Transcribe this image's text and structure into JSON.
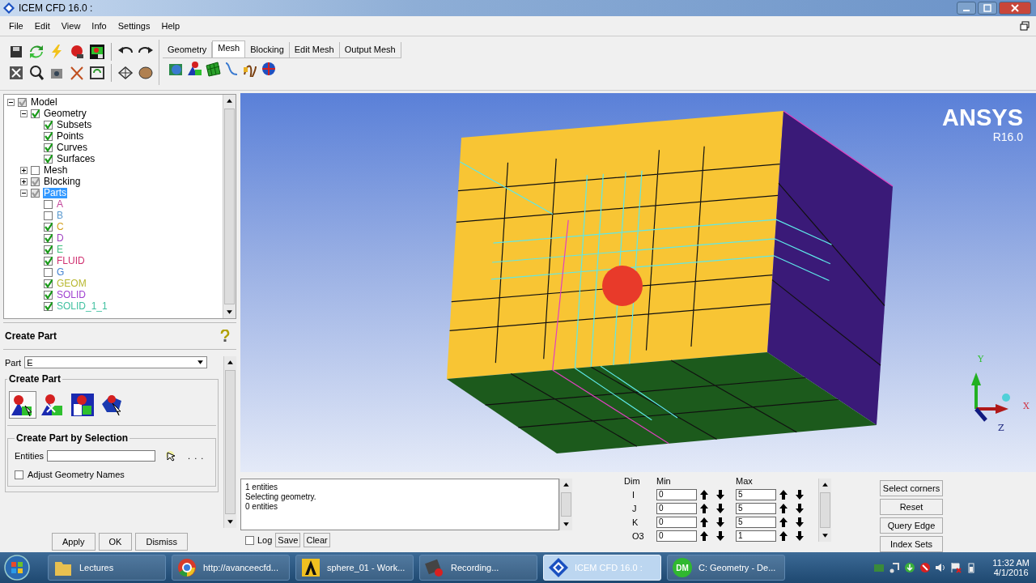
{
  "window": {
    "title": "ICEM CFD 16.0 :"
  },
  "menu": [
    "File",
    "Edit",
    "View",
    "Info",
    "Settings",
    "Help"
  ],
  "tabs": [
    {
      "label": "Geometry",
      "selected": false
    },
    {
      "label": "Mesh",
      "selected": true
    },
    {
      "label": "Blocking",
      "selected": false
    },
    {
      "label": "Edit Mesh",
      "selected": false
    },
    {
      "label": "Output Mesh",
      "selected": false
    }
  ],
  "tree": [
    {
      "label": "Model",
      "checked": true,
      "mixed": true,
      "expanded": true,
      "selected": false,
      "children": [
        {
          "label": "Geometry",
          "checked": true,
          "mixed": false,
          "expanded": true,
          "selected": false,
          "children": [
            {
              "label": "Subsets",
              "checked": true,
              "mixed": false,
              "selected": false
            },
            {
              "label": "Points",
              "checked": true,
              "mixed": false,
              "selected": false
            },
            {
              "label": "Curves",
              "checked": true,
              "mixed": false,
              "selected": false
            },
            {
              "label": "Surfaces",
              "checked": true,
              "mixed": false,
              "selected": false
            }
          ]
        },
        {
          "label": "Mesh",
          "checked": false,
          "mixed": false,
          "expanded": false,
          "selected": false
        },
        {
          "label": "Blocking",
          "checked": true,
          "mixed": true,
          "expanded": false,
          "selected": false
        },
        {
          "label": "Parts",
          "checked": true,
          "mixed": true,
          "expanded": true,
          "selected": true,
          "children": [
            {
              "label": "A",
              "checked": false,
              "mixed": false,
              "selected": false,
              "color": "#c4449a"
            },
            {
              "label": "B",
              "checked": false,
              "mixed": false,
              "selected": false,
              "color": "#5a9ad0"
            },
            {
              "label": "C",
              "checked": true,
              "mixed": false,
              "selected": false,
              "color": "#d4a020"
            },
            {
              "label": "D",
              "checked": true,
              "mixed": false,
              "selected": false,
              "color": "#a040c0"
            },
            {
              "label": "E",
              "checked": true,
              "mixed": false,
              "selected": false,
              "color": "#40c080"
            },
            {
              "label": "FLUID",
              "checked": true,
              "mixed": false,
              "selected": false,
              "color": "#d03070"
            },
            {
              "label": "G",
              "checked": false,
              "mixed": false,
              "selected": false,
              "color": "#4080d0"
            },
            {
              "label": "GEOM",
              "checked": true,
              "mixed": false,
              "selected": false,
              "color": "#b8b830"
            },
            {
              "label": "SOLID",
              "checked": true,
              "mixed": false,
              "selected": false,
              "color": "#a040d0"
            },
            {
              "label": "SOLID_1_1",
              "checked": true,
              "mixed": false,
              "selected": false,
              "color": "#40c0a0"
            }
          ]
        }
      ]
    }
  ],
  "panel": {
    "title": "Create Part",
    "part_label": "Part",
    "part_value": "E",
    "group_title": "Create Part",
    "tools": [
      {
        "selected": true
      },
      {
        "selected": false
      },
      {
        "selected": false
      },
      {
        "selected": false
      }
    ],
    "selection_title": "Create Part by Selection",
    "entities_label": "Entities",
    "more": ". . .",
    "adjust": {
      "label": "Adjust Geometry Names",
      "checked": false
    },
    "buttons": [
      "Apply",
      "OK",
      "Dismiss"
    ]
  },
  "viewport": {
    "logo": "ANSYS",
    "version": "R16.0",
    "axes": {
      "y": "Y",
      "x": "X",
      "z": "Z"
    }
  },
  "log": {
    "lines": [
      "1 entities",
      "Selecting geometry.",
      "0 entities"
    ],
    "log_option": {
      "label": "Log",
      "checked": false
    },
    "buttons": [
      "Save",
      "Clear"
    ]
  },
  "index_control": {
    "columns": [
      "Dim",
      "Min",
      "Max"
    ],
    "rows": [
      {
        "dim": "I",
        "min": "0",
        "max": "5"
      },
      {
        "dim": "J",
        "min": "0",
        "max": "5"
      },
      {
        "dim": "K",
        "min": "0",
        "max": "5"
      },
      {
        "dim": "O3",
        "min": "0",
        "max": "1"
      }
    ]
  },
  "side_buttons": [
    "Select corners",
    "Reset",
    "Query Edge",
    "Index Sets"
  ],
  "taskbar": {
    "items": [
      {
        "label": "Lectures",
        "kind": "folder",
        "selected": false
      },
      {
        "label": "http://avanceecfd...",
        "kind": "browser",
        "selected": false
      },
      {
        "label": "sphere_01 - Work...",
        "kind": "workbench",
        "selected": false
      },
      {
        "label": "Recording...",
        "kind": "recorder",
        "selected": false
      },
      {
        "label": "ICEM CFD 16.0 :",
        "kind": "icem",
        "selected": true
      },
      {
        "label": "C: Geometry - De...",
        "kind": "badge",
        "badge": "DM",
        "selected": false
      }
    ],
    "time": "11:32 AM",
    "date": "4/1/2016"
  }
}
